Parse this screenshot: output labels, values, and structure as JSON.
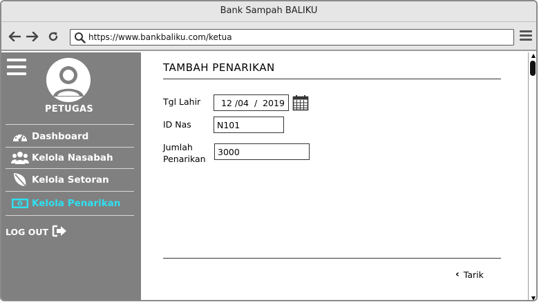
{
  "window": {
    "title": "Bank Sampah BALIKU"
  },
  "browser": {
    "url": "https://www.bankbaliku.com/ketua",
    "back_icon": "arrow-left-icon",
    "forward_icon": "arrow-right-icon",
    "reload_icon": "reload-icon",
    "menu_icon": "hamburger-icon"
  },
  "sidebar": {
    "role": "PETUGAS",
    "items": [
      {
        "label": "Dashboard",
        "icon": "dashboard-gauge-icon",
        "active": false
      },
      {
        "label": "Kelola Nasabah",
        "icon": "users-icon",
        "active": false
      },
      {
        "label": "Kelola Setoran",
        "icon": "leaf-icon",
        "active": false
      },
      {
        "label": "Kelola Penarikan",
        "icon": "money-icon",
        "active": true
      }
    ],
    "logout": "LOG OUT",
    "active_color": "#2fe0f0",
    "background_color": "#808080"
  },
  "form": {
    "title": "TAMBAH PENARIKAN",
    "fields": [
      {
        "label": "Tgl Lahir",
        "value": "12 /04  /  2019"
      },
      {
        "label": "ID Nas",
        "value": "N101"
      },
      {
        "label_line1": "Jumlah",
        "label_line2": "Penarikan",
        "value": "3000"
      }
    ],
    "submit_label": "Tarik"
  }
}
